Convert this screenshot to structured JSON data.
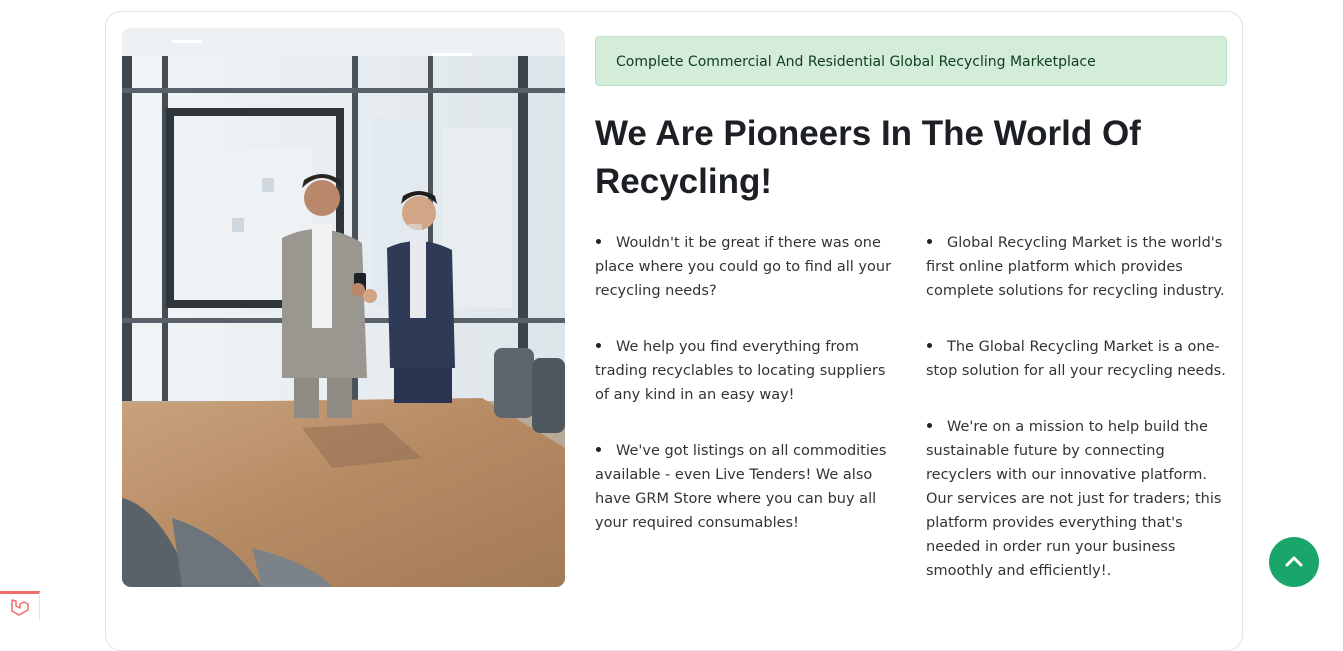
{
  "alert": {
    "text": "Complete Commercial And Residential Global Recycling Marketplace"
  },
  "heading": {
    "text": "We Are Pioneers In The World Of Recycling!"
  },
  "features": {
    "left": [
      "Wouldn't it be great if there was one place where you could go to find all your recycling needs?",
      "We help you find everything from trading recyclables to locating suppliers of any kind in an easy way!",
      "We've got listings on all commodities available - even Live Tenders! We also have GRM Store where you can buy all your required consumables!"
    ],
    "right": [
      "Global Recycling Market is the world's first online platform which provides complete solutions for recycling industry.",
      "The Global Recycling Market is a one-stop solution for all your recycling needs.",
      "We're on a mission to help build the sustainable future by connecting recyclers with our innovative platform. Our services are not just for traders; this platform provides everything that's needed in order run your business smoothly and efficiently!."
    ]
  },
  "icons": {
    "scroll_top": "chevron-up-icon",
    "corner_badge": "laravel-logo-icon"
  },
  "colors": {
    "alert_bg": "#d4ecda",
    "alert_text": "#11401f",
    "scroll_top_bg": "#1aa66a",
    "badge_accent": "#f26b6b"
  }
}
